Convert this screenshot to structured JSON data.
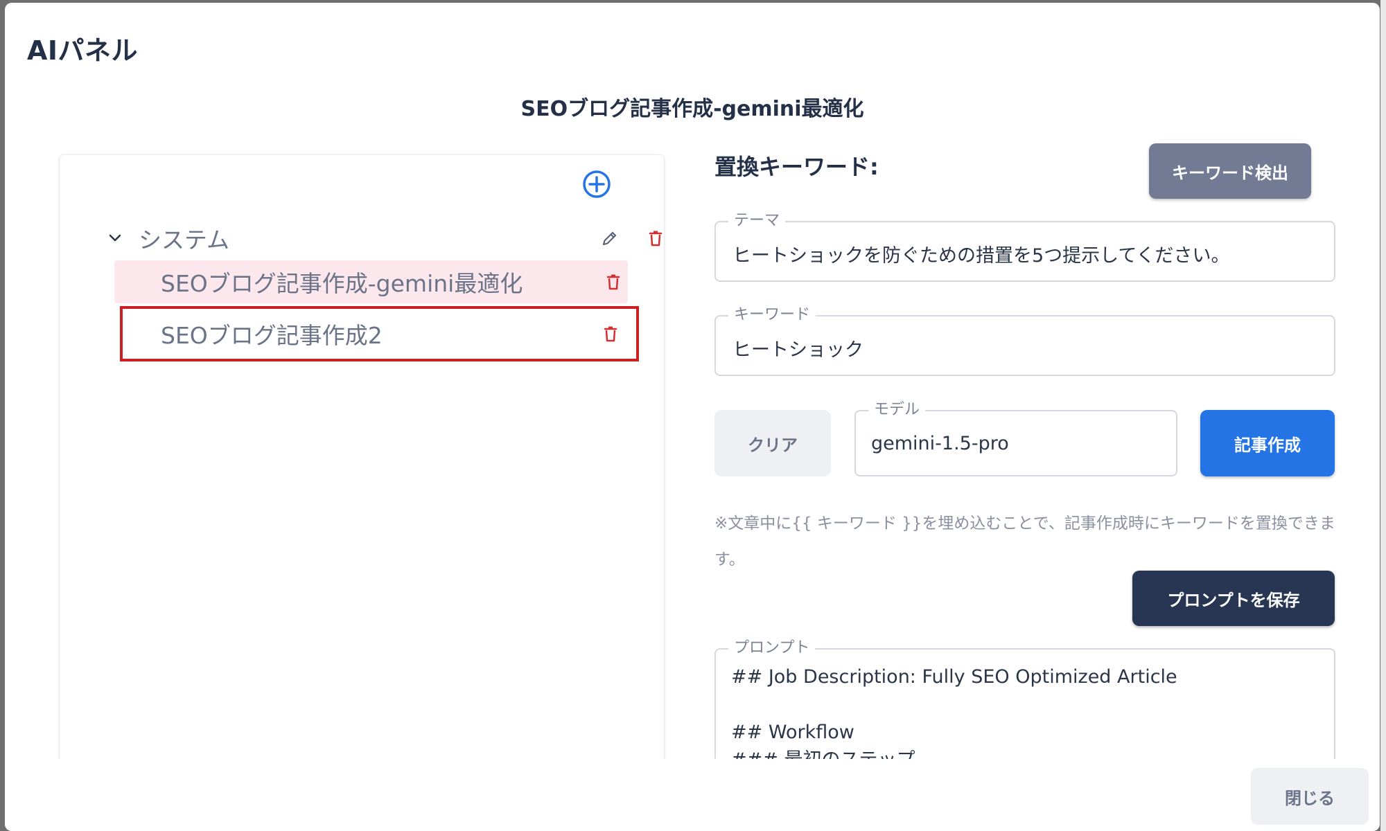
{
  "dialog": {
    "title": "AIパネル",
    "page_title": "SEOブログ記事作成-gemini最適化",
    "close_label": "閉じる"
  },
  "tree": {
    "add_icon": "plus-circle-icon",
    "folder": {
      "label": "システム",
      "expanded": true
    },
    "items": [
      {
        "label": "SEOブログ記事作成-gemini最適化",
        "selected": true
      },
      {
        "label": "SEOブログ記事作成2",
        "selected": false
      }
    ]
  },
  "keywords": {
    "header": "置換キーワード:",
    "detect_label": "キーワード検出",
    "theme": {
      "label": "テーマ",
      "value": "ヒートショックを防ぐための措置を5つ提示してください。"
    },
    "keyword": {
      "label": "キーワード",
      "value": "ヒートショック"
    },
    "clear_label": "クリア",
    "model": {
      "label": "モデル",
      "value": "gemini-1.5-pro"
    },
    "create_label": "記事作成",
    "note": "※文章中に{{ キーワード }}を埋め込むことで、記事作成時にキーワードを置換できます。",
    "save_label": "プロンプトを保存",
    "prompt": {
      "label": "プロンプト",
      "value": "## Job Description: Fully SEO Optimized Article\n\n## Workflow\n### 最初のステップ"
    }
  },
  "colors": {
    "accent_blue": "#2474e6",
    "delete_red": "#d32f2f",
    "selected_bg": "#fce7ec",
    "highlight_border": "#cc1f24",
    "dark_button": "#283653"
  }
}
